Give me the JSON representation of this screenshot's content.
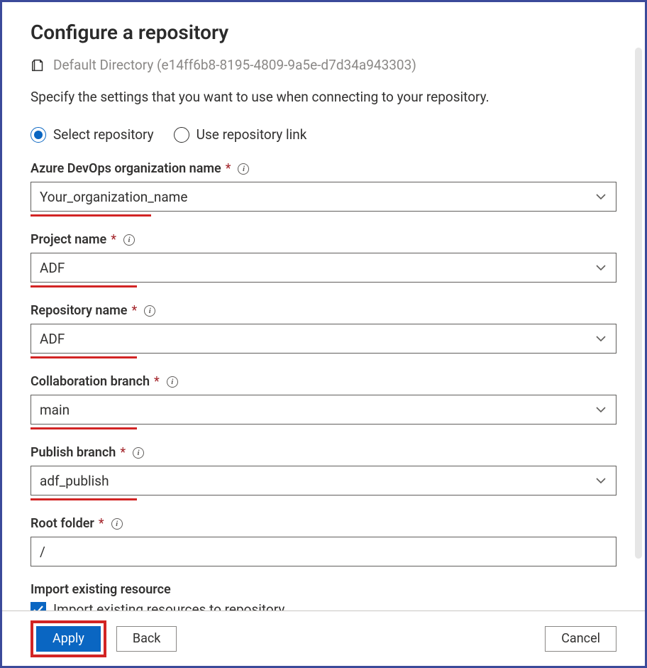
{
  "title": "Configure a repository",
  "breadcrumb": "Default Directory (e14ff6b8-8195-4809-9a5e-d7d34a943303)",
  "description": "Specify the settings that you want to use when connecting to your repository.",
  "radio": {
    "select_repo": "Select repository",
    "use_link": "Use repository link",
    "selected": "select_repo"
  },
  "fields": {
    "org": {
      "label": "Azure DevOps organization name",
      "value": "Your_organization_name"
    },
    "project": {
      "label": "Project name",
      "value": "ADF"
    },
    "repo": {
      "label": "Repository name",
      "value": "ADF"
    },
    "collab": {
      "label": "Collaboration branch",
      "value": "main"
    },
    "publish": {
      "label": "Publish branch",
      "value": "adf_publish"
    },
    "root": {
      "label": "Root folder",
      "value": "/"
    }
  },
  "import_section": {
    "heading": "Import existing resource",
    "checkbox_label": "Import existing resources to repository",
    "checked": true
  },
  "buttons": {
    "apply": "Apply",
    "back": "Back",
    "cancel": "Cancel"
  }
}
